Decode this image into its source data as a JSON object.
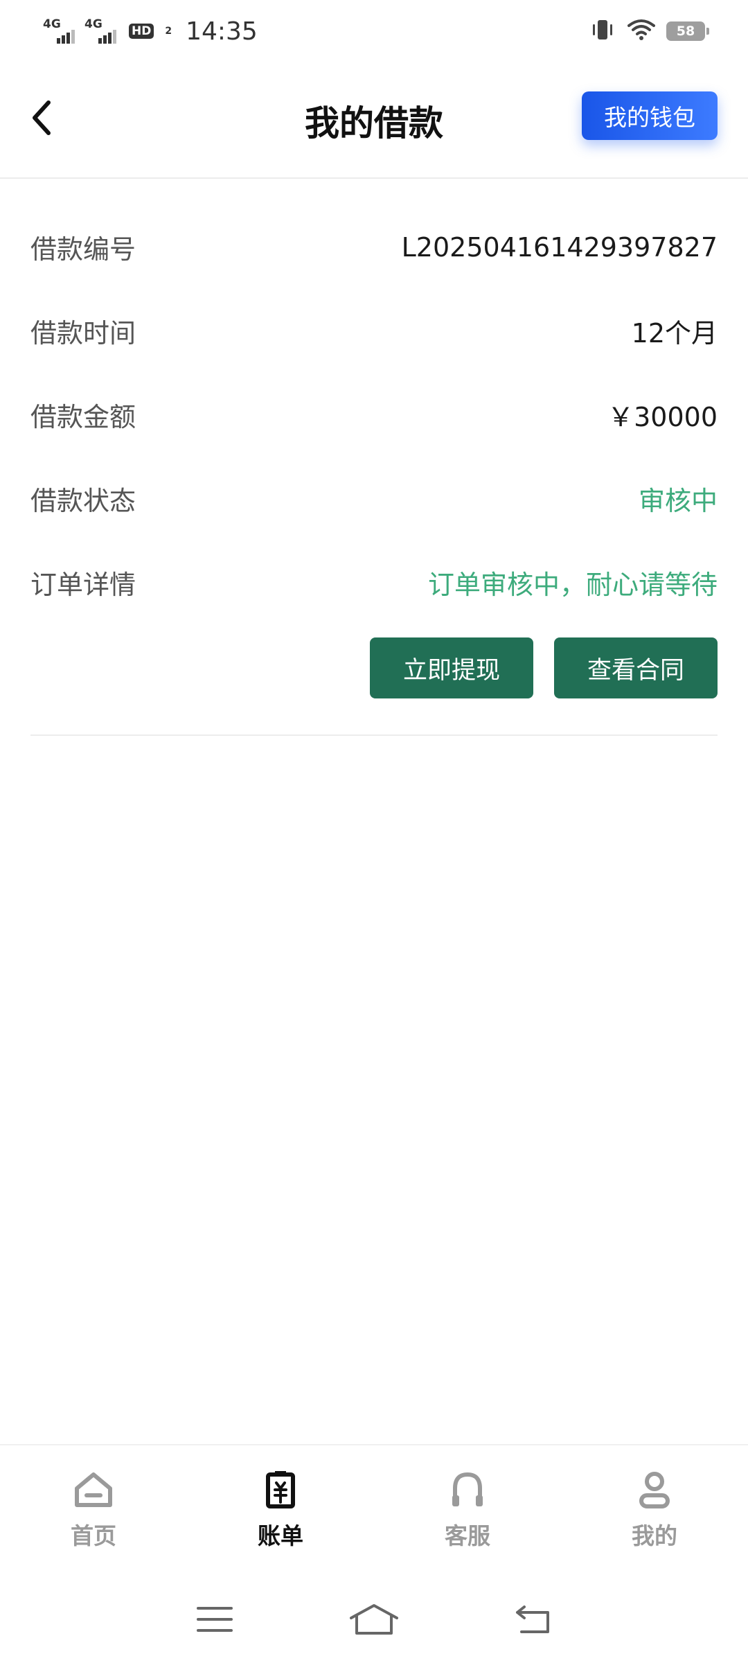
{
  "status_bar": {
    "sim1": "4G",
    "sim2": "4G",
    "hd": "HD",
    "hd_sub": "2",
    "time": "14:35",
    "battery": "58"
  },
  "header": {
    "title": "我的借款",
    "wallet_button": "我的钱包"
  },
  "loan": {
    "rows": [
      {
        "label": "借款编号",
        "value": "L202504161429397827"
      },
      {
        "label": "借款时间",
        "value": "12个月"
      },
      {
        "label": "借款金额",
        "value": "￥30000"
      },
      {
        "label": "借款状态",
        "value": "审核中"
      },
      {
        "label": "订单详情",
        "value": "订单审核中，耐心请等待"
      }
    ],
    "actions": {
      "withdraw": "立即提现",
      "contract": "查看合同"
    }
  },
  "tabbar": {
    "items": [
      {
        "label": "首页",
        "icon": "home-icon"
      },
      {
        "label": "账单",
        "icon": "bill-icon"
      },
      {
        "label": "客服",
        "icon": "headset-icon"
      },
      {
        "label": "我的",
        "icon": "user-icon"
      }
    ],
    "active": "账单"
  },
  "colors": {
    "accent_green": "#216f55",
    "status_green": "#3dab7c",
    "wallet_blue": "#1a56e8"
  }
}
